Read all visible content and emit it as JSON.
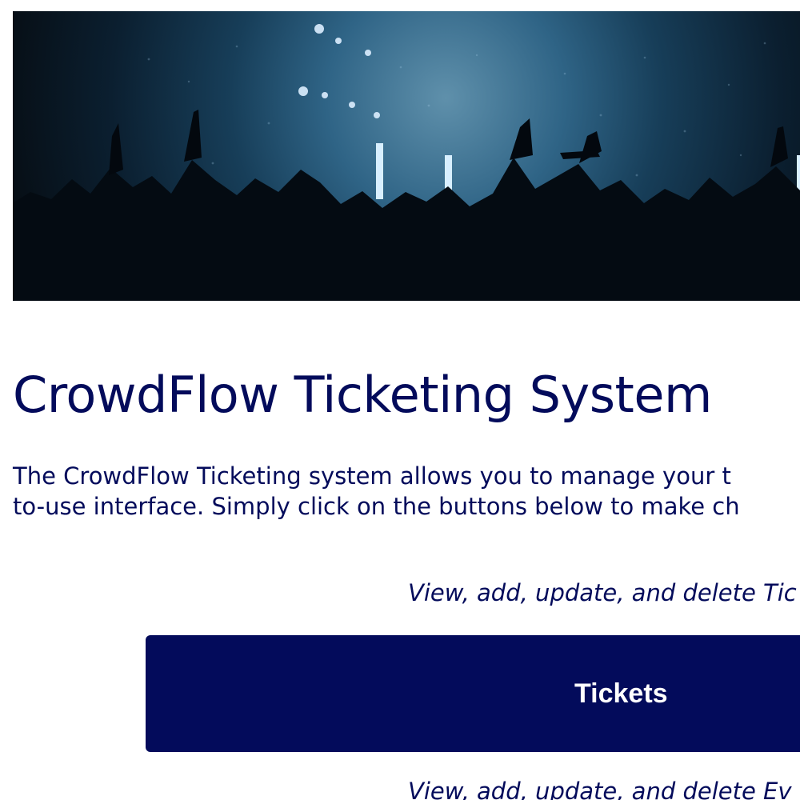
{
  "hero": {
    "image_description": "concert-crowd-photo",
    "icon": "concert-crowd-image"
  },
  "main": {
    "title": "CrowdFlow Ticketing System",
    "intro_line1": "The CrowdFlow Ticketing system allows you to manage your t",
    "intro_line2": "to-use interface. Simply click on the buttons below to make ch"
  },
  "sections": [
    {
      "description": "View, add, update, and delete Tic",
      "button_label": "Tickets"
    },
    {
      "description": "View, add, update, and delete Ev"
    }
  ],
  "colors": {
    "primary": "#030b5b",
    "button_text": "#ffffff",
    "hero_accent": "#5f90ab"
  }
}
